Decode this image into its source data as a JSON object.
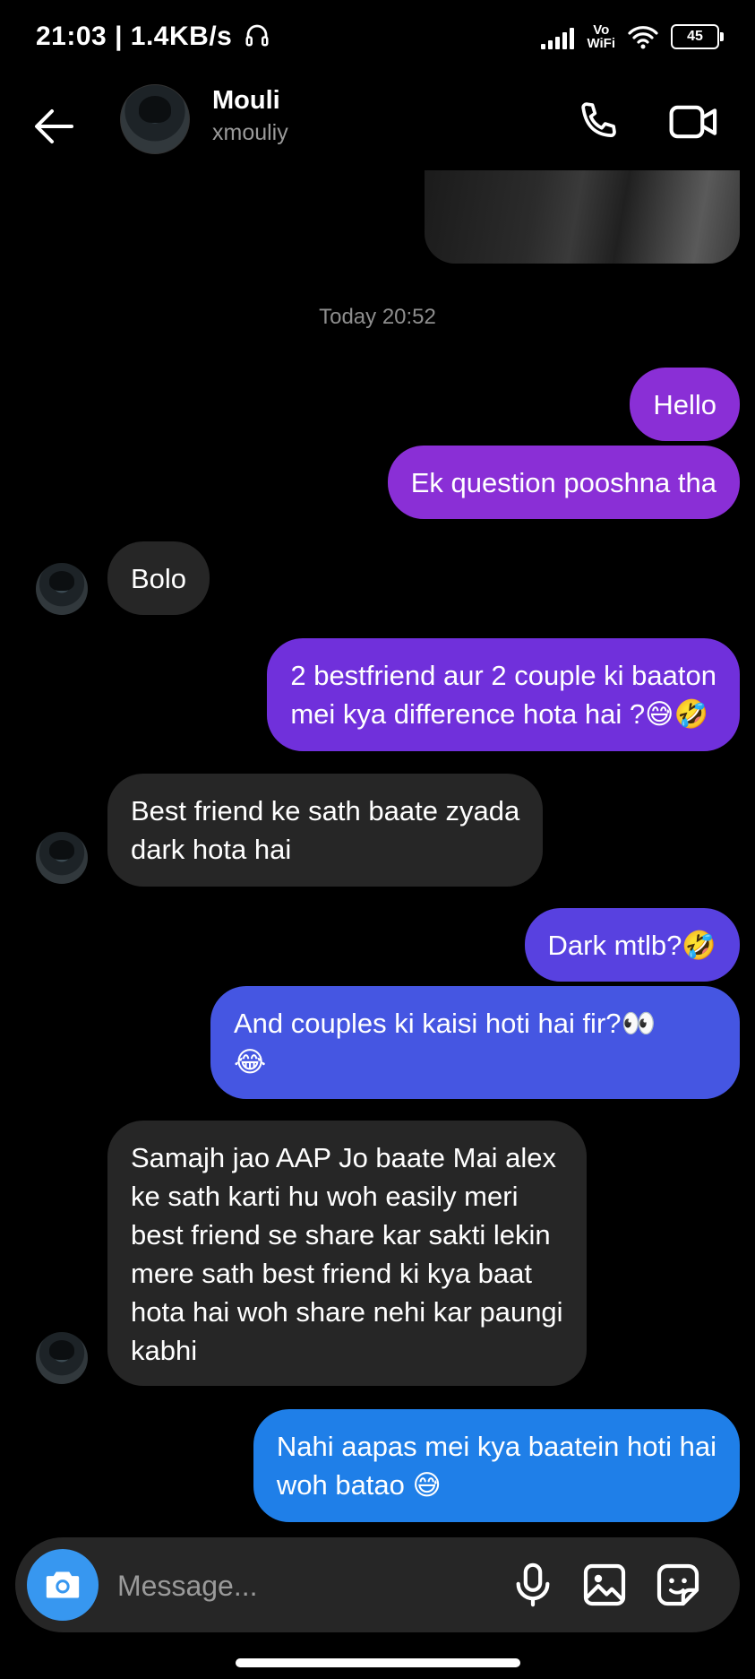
{
  "status_bar": {
    "left_text": "21:03 | 1.4KB/s",
    "vowifi": "Vo\nWiFi",
    "battery": "45"
  },
  "header": {
    "name": "Mouli",
    "username": "xmouliy"
  },
  "timestamp": "Today 20:52",
  "messages": [
    {
      "from": "me",
      "text": "Hello",
      "color": "#8a2fd6"
    },
    {
      "from": "me",
      "text": "Ek question pooshna tha",
      "color": "#8a2fd6"
    },
    {
      "from": "them",
      "text": "Bolo"
    },
    {
      "from": "me",
      "text": "2 bestfriend aur 2 couple ki baaton\nmei kya difference hota hai ?😅🤣",
      "color": "#7030db"
    },
    {
      "from": "them",
      "text": "Best friend ke sath baate zyada\ndark hota hai"
    },
    {
      "from": "me",
      "text": "Dark mtlb?🤣",
      "color": "#5841e0"
    },
    {
      "from": "me",
      "text": "And couples ki kaisi hoti hai fir?👀\n😂",
      "color": "#4556e2"
    },
    {
      "from": "them",
      "text": "Samajh jao AAP Jo baate Mai alex\nke sath karti hu woh easily meri\nbest friend se share kar sakti lekin\nmere sath best friend ki kya baat\nhota hai woh share nehi kar paungi\nkabhi"
    },
    {
      "from": "me",
      "text": "Nahi aapas mei kya baatein hoti hai\nwoh batao 😅",
      "color": "#1f7fe8"
    }
  ],
  "composer": {
    "placeholder": "Message..."
  },
  "colors": {
    "camera_button": "#3797f0",
    "incoming_bubble": "#262626"
  },
  "icons": [
    "back-arrow-icon",
    "phone-icon",
    "video-camera-icon",
    "camera-icon",
    "microphone-icon",
    "gallery-icon",
    "sticker-icon"
  ]
}
